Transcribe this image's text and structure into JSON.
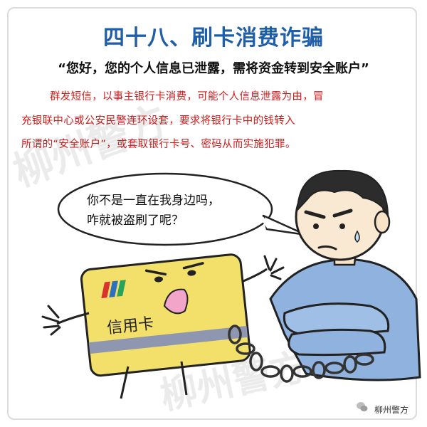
{
  "header": {
    "title": "四十八、刷卡消费诈骗",
    "quote": "“您好，您的个人信息已泄露，需将资金转到安全账户”"
  },
  "description": {
    "line1": "群发短信，以事主银行卡消费，可能个人信息泄露为由，冒",
    "line2": "充银联中心或公安民警连环设套，要求将银行卡中的钱转入",
    "line3": "所谓的“安全账户”，或套取银行卡号、密码从而实施犯罪。"
  },
  "comic": {
    "speech_line1": "你不是一直在我身边吗，",
    "speech_line2": "咋就被盗刷了呢？",
    "card_label": "信用卡"
  },
  "watermark": {
    "text": "柳州警方",
    "logo_icon": "wechat-bubble-icon"
  },
  "colors": {
    "title": "#1f5ea8",
    "desc": "#d11b1b",
    "card": "#f3e06a",
    "shirt": "#8fb2de"
  }
}
